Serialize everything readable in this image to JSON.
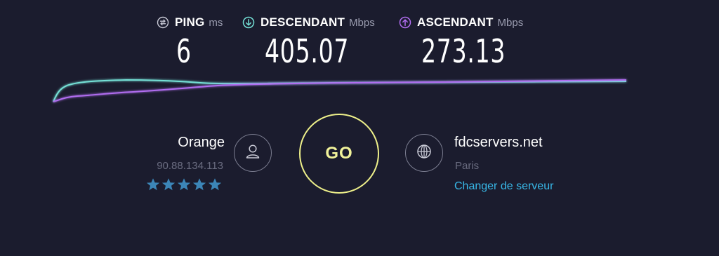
{
  "metrics": {
    "ping": {
      "label": "PING",
      "unit": "ms",
      "value": "6",
      "icon": "ping-icon"
    },
    "download": {
      "label": "DESCENDANT",
      "unit": "Mbps",
      "value": "405.07",
      "icon": "download-arrow-icon"
    },
    "upload": {
      "label": "ASCENDANT",
      "unit": "Mbps",
      "value": "273.13",
      "icon": "upload-arrow-icon"
    }
  },
  "colors": {
    "background": "#1b1c2e",
    "download": "#74e0d6",
    "upload": "#b16df0",
    "go": "#eef08a",
    "link": "#38b8e8",
    "star": "#3c86b8"
  },
  "provider": {
    "name": "Orange",
    "ip": "90.88.134.113",
    "rating": 5,
    "max_rating": 5,
    "icon": "user-icon"
  },
  "go_button": {
    "label": "GO"
  },
  "server": {
    "name": "fdcservers.net",
    "city": "Paris",
    "change_label": "Changer de serveur",
    "icon": "globe-icon"
  }
}
